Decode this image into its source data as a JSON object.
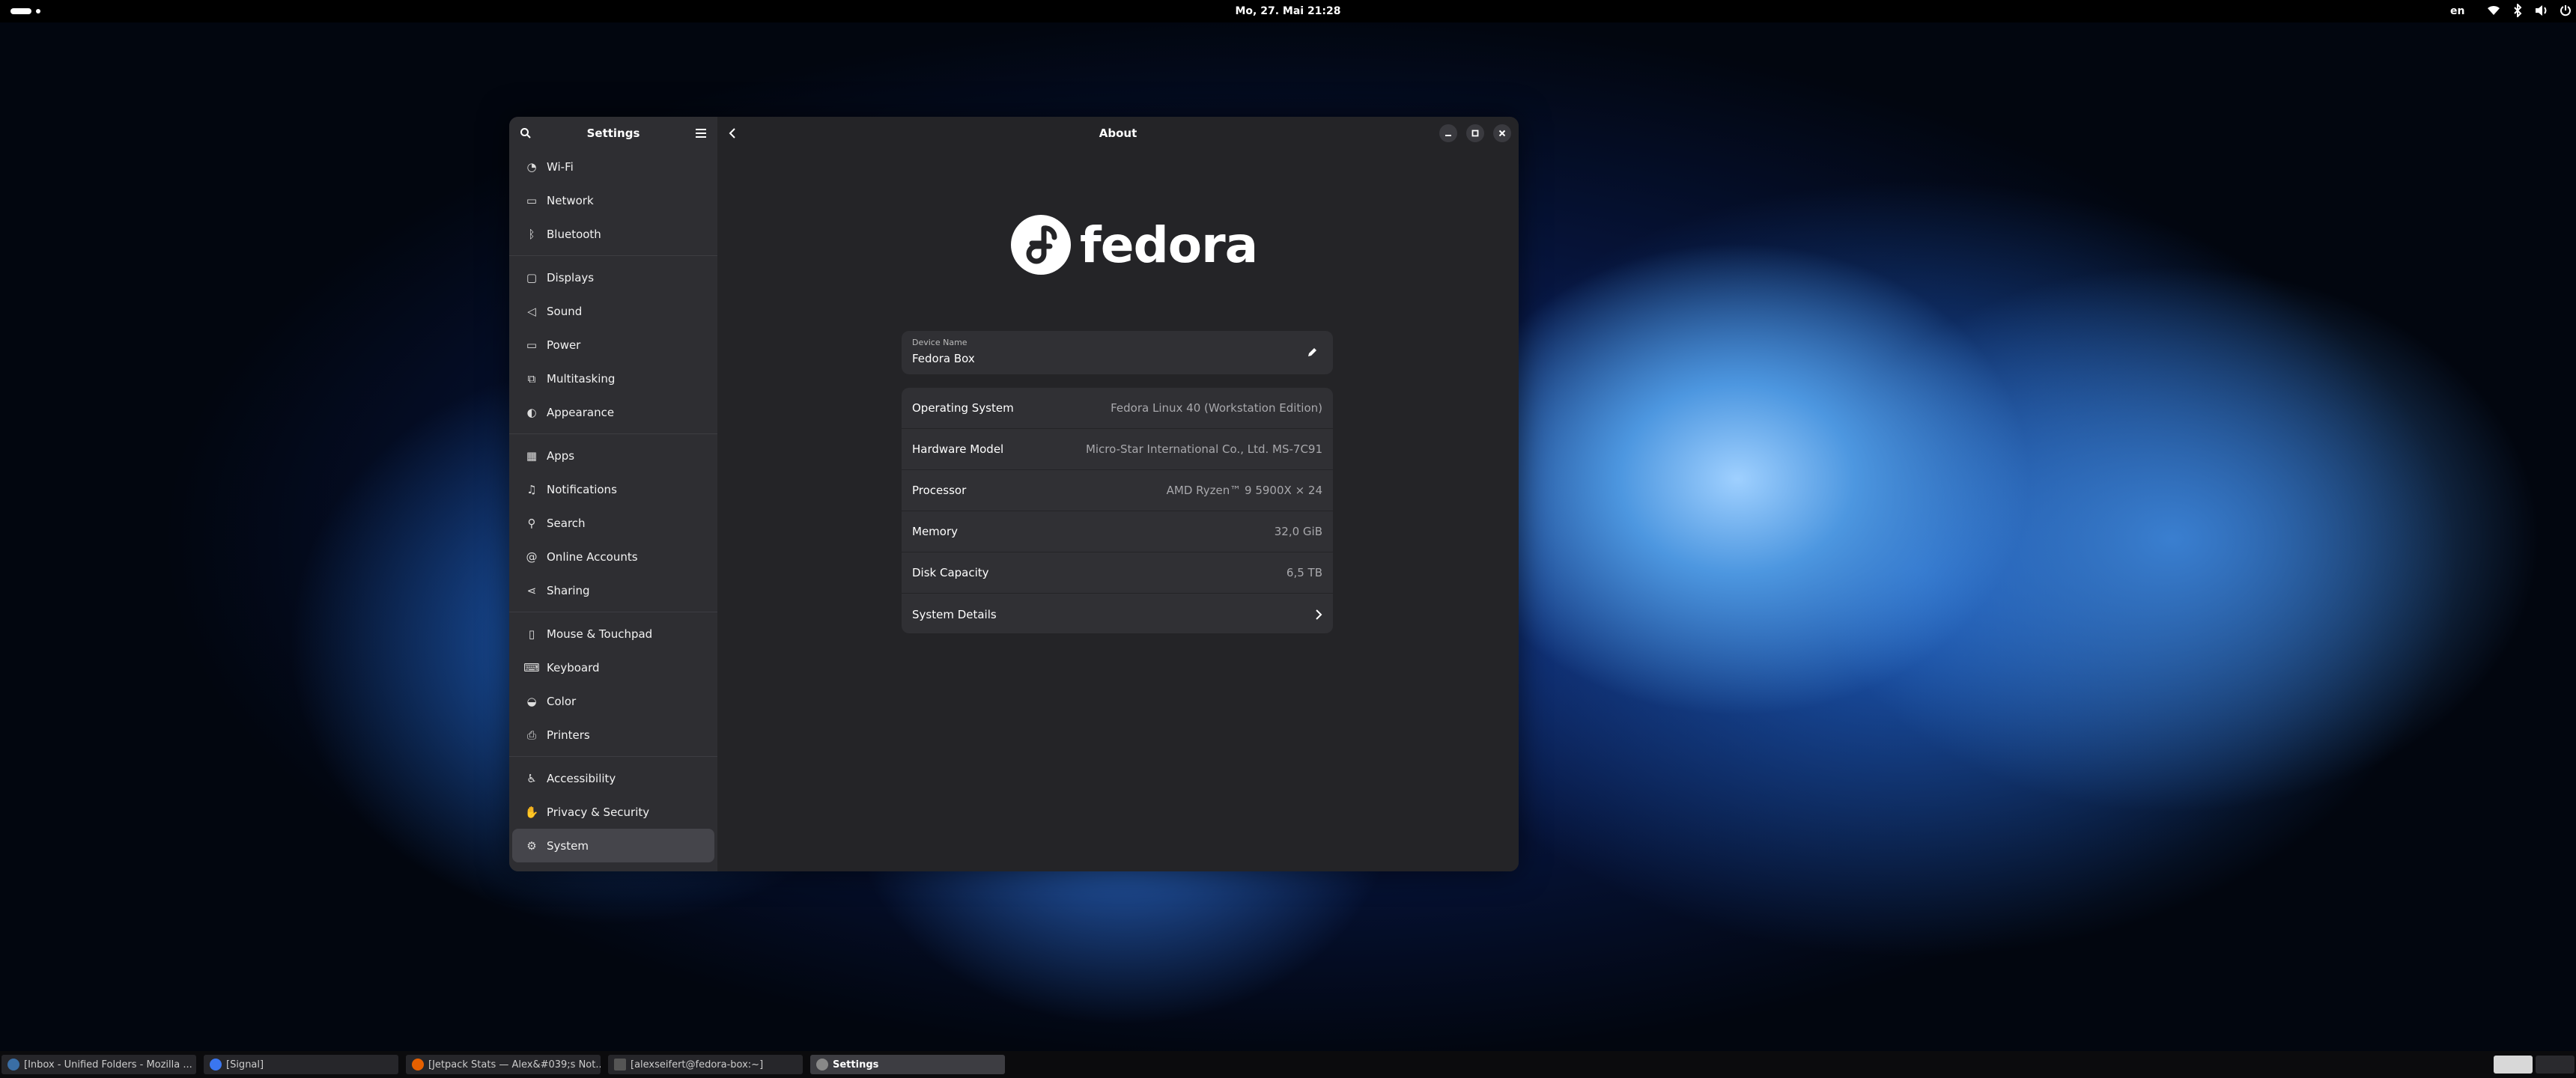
{
  "topbar": {
    "clock": "Mo, 27. Mai  21:28",
    "language": "en",
    "tray_icons": [
      "wifi-icon",
      "bluetooth-icon",
      "volume-icon",
      "power-icon"
    ]
  },
  "window": {
    "sidebar": {
      "title": "Settings",
      "groups": [
        [
          {
            "label": "Wi-Fi",
            "icon": "wifi-icon"
          },
          {
            "label": "Network",
            "icon": "network-icon"
          },
          {
            "label": "Bluetooth",
            "icon": "bluetooth-icon"
          }
        ],
        [
          {
            "label": "Displays",
            "icon": "display-icon"
          },
          {
            "label": "Sound",
            "icon": "sound-icon"
          },
          {
            "label": "Power",
            "icon": "power-icon"
          },
          {
            "label": "Multitasking",
            "icon": "multitasking-icon"
          },
          {
            "label": "Appearance",
            "icon": "appearance-icon"
          }
        ],
        [
          {
            "label": "Apps",
            "icon": "apps-icon"
          },
          {
            "label": "Notifications",
            "icon": "bell-icon"
          },
          {
            "label": "Search",
            "icon": "search-icon"
          },
          {
            "label": "Online Accounts",
            "icon": "at-icon"
          },
          {
            "label": "Sharing",
            "icon": "share-icon"
          }
        ],
        [
          {
            "label": "Mouse & Touchpad",
            "icon": "mouse-icon"
          },
          {
            "label": "Keyboard",
            "icon": "keyboard-icon"
          },
          {
            "label": "Color",
            "icon": "color-icon"
          },
          {
            "label": "Printers",
            "icon": "printer-icon"
          }
        ],
        [
          {
            "label": "Accessibility",
            "icon": "accessibility-icon"
          },
          {
            "label": "Privacy & Security",
            "icon": "privacy-icon"
          },
          {
            "label": "System",
            "icon": "gear-icon",
            "selected": true
          }
        ]
      ]
    },
    "content": {
      "title": "About",
      "logo_text": "fedora",
      "device": {
        "label": "Device Name",
        "value": "Fedora Box"
      },
      "rows": [
        {
          "label": "Operating System",
          "value": "Fedora Linux 40 (Workstation Edition)"
        },
        {
          "label": "Hardware Model",
          "value": "Micro-Star International Co., Ltd. MS-7C91"
        },
        {
          "label": "Processor",
          "value": "AMD Ryzen™ 9 5900X × 24"
        },
        {
          "label": "Memory",
          "value": "32,0 GiB"
        },
        {
          "label": "Disk Capacity",
          "value": "6,5 TB"
        },
        {
          "label": "System Details",
          "value": ""
        }
      ]
    }
  },
  "taskbar": {
    "tasks": [
      {
        "label": "[Inbox - Unified Folders - Mozilla ...",
        "icon_color": "#3a6ea5"
      },
      {
        "label": "[Signal]",
        "icon_color": "#3a76f0"
      },
      {
        "label": "[Jetpack Stats — Alex&#039;s Not...",
        "icon_color": "#e66000"
      },
      {
        "label": "[alexseifert@fedora-box:~]",
        "icon_color": "#555555"
      },
      {
        "label": "Settings",
        "icon_color": "#888888",
        "active": true
      }
    ]
  }
}
